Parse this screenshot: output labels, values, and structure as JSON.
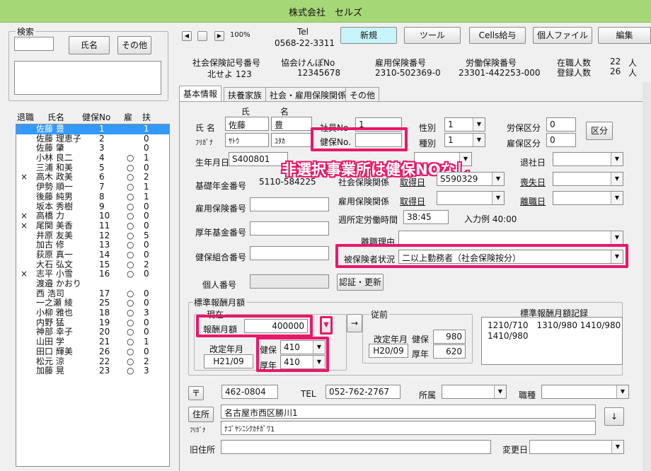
{
  "window_title": "株式会社　セルズ",
  "search": {
    "group_label": "検索",
    "name_button": "氏名",
    "other_button": "その他"
  },
  "list": {
    "headers": [
      "退職",
      "氏名",
      "健保No",
      "雇",
      "扶"
    ],
    "rows": [
      {
        "ret": "",
        "name": "佐藤 豊",
        "no": "1",
        "emp": "",
        "dep": "1"
      },
      {
        "ret": "",
        "name": "佐藤 理恵子",
        "no": "2",
        "emp": "",
        "dep": "0"
      },
      {
        "ret": "",
        "name": "佐藤 肇",
        "no": "3",
        "emp": "",
        "dep": "0"
      },
      {
        "ret": "",
        "name": "小林 良二",
        "no": "4",
        "emp": "○",
        "dep": "1"
      },
      {
        "ret": "",
        "name": "三浦 和美",
        "no": "5",
        "emp": "○",
        "dep": "0"
      },
      {
        "ret": "×",
        "name": "高木 政美",
        "no": "6",
        "emp": "○",
        "dep": "2"
      },
      {
        "ret": "",
        "name": "伊勢 順一",
        "no": "7",
        "emp": "○",
        "dep": "1"
      },
      {
        "ret": "",
        "name": "後藤 純男",
        "no": "8",
        "emp": "○",
        "dep": "1"
      },
      {
        "ret": "",
        "name": "坂本 秀樹",
        "no": "9",
        "emp": "○",
        "dep": "0"
      },
      {
        "ret": "×",
        "name": "高橋 力",
        "no": "10",
        "emp": "○",
        "dep": "0"
      },
      {
        "ret": "×",
        "name": "尾関 美香",
        "no": "11",
        "emp": "○",
        "dep": "0"
      },
      {
        "ret": "",
        "name": "井原 友美",
        "no": "12",
        "emp": "○",
        "dep": "5"
      },
      {
        "ret": "",
        "name": "加古 修",
        "no": "13",
        "emp": "○",
        "dep": "0"
      },
      {
        "ret": "",
        "name": "荻原 真一",
        "no": "14",
        "emp": "○",
        "dep": "0"
      },
      {
        "ret": "",
        "name": "大石 弘文",
        "no": "15",
        "emp": "○",
        "dep": "2"
      },
      {
        "ret": "×",
        "name": "志平 小雪",
        "no": "16",
        "emp": "○",
        "dep": "0"
      },
      {
        "ret": "",
        "name": "渡邉 かおり",
        "no": "",
        "emp": "",
        "dep": ""
      },
      {
        "ret": "",
        "name": "西 浩司",
        "no": "17",
        "emp": "○",
        "dep": "0"
      },
      {
        "ret": "",
        "name": "一之瀬 綾",
        "no": "25",
        "emp": "○",
        "dep": "0"
      },
      {
        "ret": "",
        "name": "小柳 雅也",
        "no": "18",
        "emp": "○",
        "dep": "3"
      },
      {
        "ret": "",
        "name": "内野 猛",
        "no": "19",
        "emp": "○",
        "dep": "0"
      },
      {
        "ret": "",
        "name": "神部 幸子",
        "no": "20",
        "emp": "○",
        "dep": "0"
      },
      {
        "ret": "",
        "name": "山田 学",
        "no": "21",
        "emp": "○",
        "dep": "1"
      },
      {
        "ret": "",
        "name": "田口 輝美",
        "no": "26",
        "emp": "○",
        "dep": "0"
      },
      {
        "ret": "",
        "name": "松元 涼",
        "no": "22",
        "emp": "○",
        "dep": "2"
      },
      {
        "ret": "",
        "name": "加藤 晃",
        "no": "23",
        "emp": "○",
        "dep": "3"
      }
    ]
  },
  "toolbar": {
    "zoom": "100%",
    "tel_label": "Tel",
    "tel_value": "0568-22-3311",
    "new": "新規",
    "tool": "ツール",
    "cells_pay": "Cells給与",
    "personal_file": "個人ファイル",
    "edit": "編集"
  },
  "info": {
    "shaho_label": "社会保険記号番号",
    "shaho_value": "北せよ 123",
    "kyokai_label": "協会けんぽNo",
    "kyokai_value": "12345678",
    "koyo_label": "雇用保険番号",
    "koyo_value": "2310-502369-0",
    "rodo_label": "労働保険番号",
    "rodo_value": "23301-442253-000",
    "zaishoku_label": "在職人数",
    "zaishoku_value": "22",
    "unit": "人",
    "toroku_label": "登録人数",
    "toroku_value": "26"
  },
  "tabs": [
    "基本情報",
    "扶養家族",
    "社会・雇用保険関係",
    "その他"
  ],
  "form": {
    "shi": "氏",
    "mei": "名",
    "name_label": "氏 名",
    "furigana_label": "ﾌﾘｶﾞﾅ",
    "last_name": "佐藤",
    "first_name": "豊",
    "last_kana": "ｻﾄｳ",
    "first_kana": "ﾕﾀｶ",
    "shain_no_label": "社員No",
    "shain_no": "1",
    "kenpo_no_label": "健保No.",
    "kenpo_no": "",
    "gender_label": "性別",
    "gender": "1",
    "type_label": "種別",
    "type": "1",
    "rouho_label": "労保区分",
    "rouho": "0",
    "koho_label": "雇保区分",
    "koho": "0",
    "kubun_button": "区分",
    "birth_label": "生年月日",
    "birth": "S400801",
    "taisha_label": "退社日",
    "kiso_label": "基礎年金番号",
    "kiso": "5110-584225",
    "shakai_label": "社会保険関係",
    "shutoku_label": "取得日",
    "shutoku": "S590329",
    "soushitsu_label": "喪失日",
    "koyo_no_label": "雇用保険番号",
    "koyo_kankei_label": "雇用保険関係",
    "shutoku2_label": "取得日",
    "rishoku_label": "離職日",
    "weekly_label": "週所定労働時間",
    "weekly": "38:45",
    "example": "入力例 40:00",
    "kikin_label": "厚年基金番号",
    "riyu_label": "離職理由",
    "kumiai_label": "健保組合番号",
    "hihoken_label": "被保険者状況",
    "hihoken": "二以上勤務者（社会保険按分）",
    "kojin_label": "個人番号",
    "ninsho_button": "認証・更新",
    "hyojun_label": "標準報酬月額",
    "genzai_label": "現在",
    "hoshu_label": "報酬月額",
    "hoshu": "400000",
    "kaitei_label": "改定年月",
    "kaitei": "H21/09",
    "kenpo_label": "健保",
    "kenpo": "410",
    "konen_label": "厚年",
    "konen": "410",
    "arrow_button": "→",
    "juzen_label": "従前",
    "prev_kaitei_label": "改定年月",
    "prev_kaitei": "H20/09",
    "prev_kenpo_label": "健保",
    "prev_kenpo": "980",
    "prev_konen_label": "厚年",
    "prev_konen": "620",
    "record_label": "標準報酬月額記録",
    "record_line1": "1210/710　1310/980 1410/980",
    "record_line2": "1410/980",
    "zip_button": "〒",
    "zip": "462-0804",
    "tel_label": "TEL",
    "tel": "052-762-2767",
    "shozoku_label": "所属",
    "shokushu_label": "職種",
    "address_button": "住所",
    "address": "名古屋市西区勝川1",
    "address_kana": "ﾅｺﾞﾔｼﾆｼｸｶﾁｶﾞﾜ1",
    "down_button": "↓",
    "old_address_label": "旧住所",
    "henko_label": "変更日"
  },
  "annotation": "非選択事業所は健保NOなし",
  "colors": {
    "title_bar": "#a6d776",
    "new_button": "#c7f3fb",
    "highlight": "#e8186a",
    "selection": "#3399ff"
  }
}
